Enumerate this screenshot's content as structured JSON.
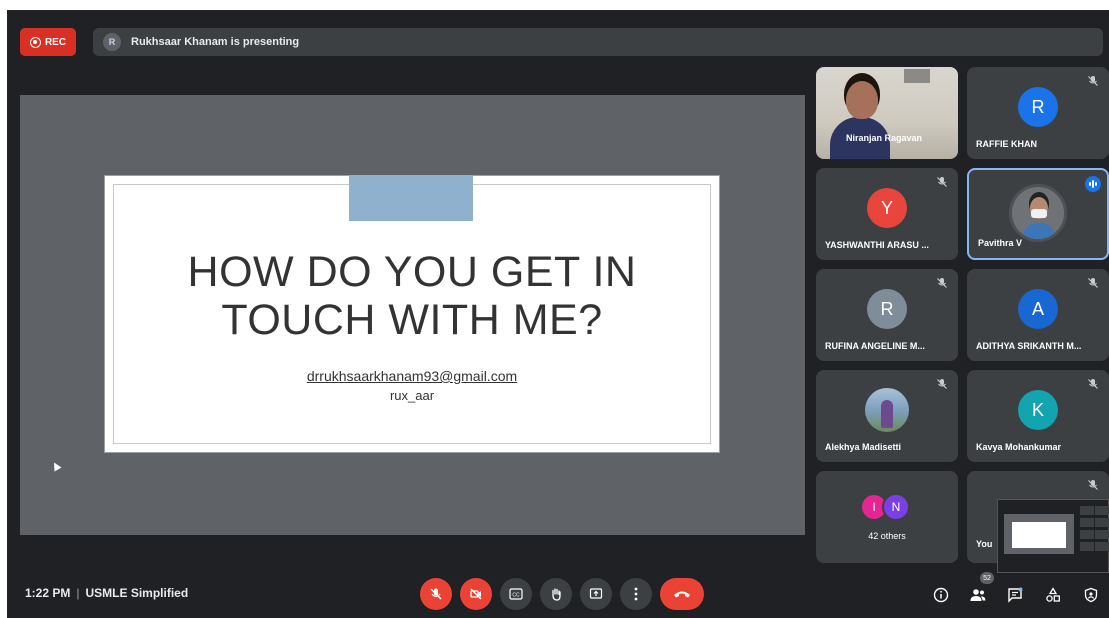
{
  "top_bar": {
    "rec_label": "REC",
    "presenter_initial": "R",
    "presenting_text": "Rukhsaar Khanam is presenting"
  },
  "slide": {
    "title_line1": "HOW DO YOU GET IN",
    "title_line2": "TOUCH WITH ME?",
    "email": "drrukhsaarkhanam93@gmail.com",
    "handle": "rux_aar"
  },
  "participants": [
    {
      "name": "Niranjan Ragavan",
      "initial": "",
      "avatar_color": "",
      "muted": false
    },
    {
      "name": "RAFFIE KHAN",
      "initial": "R",
      "avatar_color": "#1a73e8",
      "muted": true
    },
    {
      "name": "YASHWANTHI ARASU ...",
      "initial": "Y",
      "avatar_color": "#e8453c",
      "muted": true
    },
    {
      "name": "Pavithra V",
      "initial": "",
      "avatar_color": "",
      "muted": false,
      "speaking": true
    },
    {
      "name": "RUFINA ANGELINE M...",
      "initial": "R",
      "avatar_color": "#7f8c99",
      "muted": true
    },
    {
      "name": "ADITHYA SRIKANTH M...",
      "initial": "A",
      "avatar_color": "#1967d2",
      "muted": true
    },
    {
      "name": "Alekhya Madisetti",
      "initial": "",
      "avatar_color": "",
      "muted": true
    },
    {
      "name": "Kavya Mohankumar",
      "initial": "K",
      "avatar_color": "#12a4af",
      "muted": true
    }
  ],
  "others": {
    "initial_1": "I",
    "color_1": "#e52592",
    "initial_2": "N",
    "color_2": "#7b3fe4",
    "label": "42 others"
  },
  "self_tile": {
    "name": "You"
  },
  "bottom_bar": {
    "time": "1:22 PM",
    "separator": "|",
    "meeting_name": "USMLE Simplified",
    "people_count": "52"
  },
  "colors": {
    "background": "#202124",
    "tile": "#3c4043",
    "danger": "#ea4335",
    "accent": "#8ab4f8"
  },
  "icons": {
    "mic": "mic-off-icon",
    "camera": "camera-off-icon",
    "captions": "captions-icon",
    "hand": "raise-hand-icon",
    "present": "present-screen-icon",
    "more": "more-vert-icon",
    "end_call": "end-call-icon",
    "info": "info-icon",
    "people": "people-icon",
    "chat": "chat-icon",
    "activities": "activities-icon",
    "host": "host-controls-icon"
  }
}
